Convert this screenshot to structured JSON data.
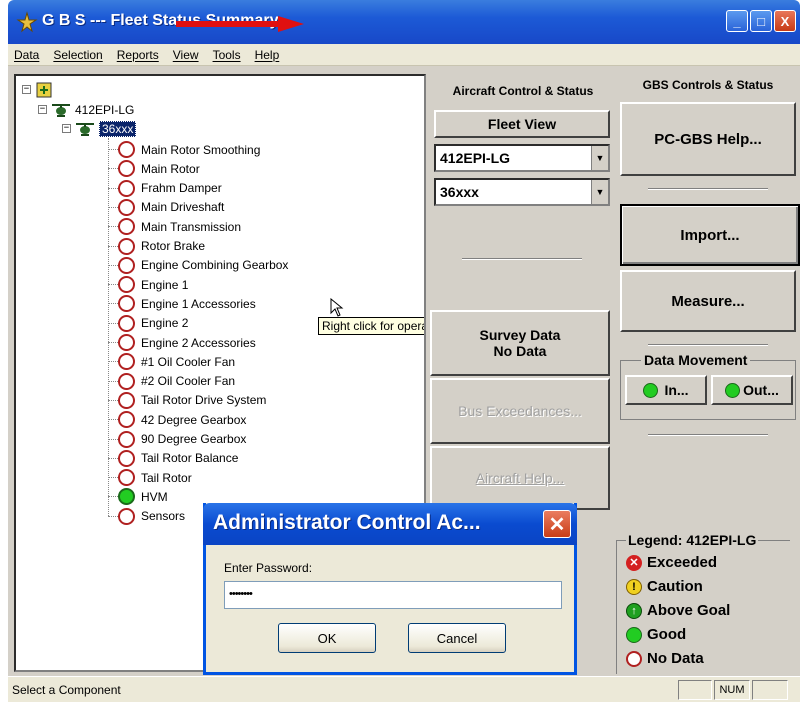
{
  "window": {
    "title": "G B S --- Fleet Status Summary",
    "controls": [
      "_",
      "□",
      "X"
    ]
  },
  "menu": [
    "Data",
    "Selection",
    "Reports",
    "View",
    "Tools",
    "Help"
  ],
  "tree": {
    "fleet_node": "412EPI-LG",
    "aircraft_node": "36xxx",
    "components": [
      {
        "label": "Main Rotor Smoothing",
        "status": "nodata"
      },
      {
        "label": "Main Rotor",
        "status": "nodata"
      },
      {
        "label": "Frahm Damper",
        "status": "nodata"
      },
      {
        "label": "Main Driveshaft",
        "status": "nodata"
      },
      {
        "label": "Main Transmission",
        "status": "nodata"
      },
      {
        "label": "Rotor Brake",
        "status": "nodata"
      },
      {
        "label": "Engine Combining Gearbox",
        "status": "nodata"
      },
      {
        "label": "Engine 1",
        "status": "nodata"
      },
      {
        "label": "Engine 1 Accessories",
        "status": "nodata"
      },
      {
        "label": "Engine 2",
        "status": "nodata"
      },
      {
        "label": "Engine 2 Accessories",
        "status": "nodata"
      },
      {
        "label": "#1 Oil Cooler Fan",
        "status": "nodata"
      },
      {
        "label": "#2 Oil Cooler Fan",
        "status": "nodata"
      },
      {
        "label": "Tail Rotor Drive System",
        "status": "nodata"
      },
      {
        "label": "42 Degree Gearbox",
        "status": "nodata"
      },
      {
        "label": "90 Degree Gearbox",
        "status": "nodata"
      },
      {
        "label": "Tail Rotor Balance",
        "status": "nodata"
      },
      {
        "label": "Tail Rotor",
        "status": "nodata"
      },
      {
        "label": "HVM",
        "status": "good"
      },
      {
        "label": "Sensors",
        "status": "nodata"
      }
    ],
    "tooltip": "Right click for operations."
  },
  "aircraft_panel": {
    "title": "Aircraft Control & Status",
    "fleet_view": "Fleet View",
    "fleet_select": "412EPI-LG",
    "aircraft_select": "36xxx",
    "survey_line1": "Survey Data",
    "survey_line2": "No Data",
    "bus_exceedances": "Bus Exceedances...",
    "aircraft_help": "Aircraft Help..."
  },
  "gbs_panel": {
    "title": "GBS Controls & Status",
    "help": "PC-GBS Help...",
    "import": "Import...",
    "measure": "Measure...",
    "data_movement": "Data Movement",
    "in": "In...",
    "out": "Out..."
  },
  "legend": {
    "title": "Legend: 412EPI-LG",
    "items": [
      {
        "label": "Exceeded",
        "color": "#d42020"
      },
      {
        "label": "Caution",
        "color": "#f0d020"
      },
      {
        "label": "Above Goal",
        "color": "#20a020"
      },
      {
        "label": "Good",
        "color": "#22cc22"
      },
      {
        "label": "No Data",
        "color": "#ffffff"
      }
    ]
  },
  "dialog": {
    "title": "Administrator Control Ac...",
    "label": "Enter Password:",
    "password": "••••••••",
    "ok": "OK",
    "cancel": "Cancel"
  },
  "statusbar": {
    "text": "Select a Component",
    "num": "NUM"
  }
}
